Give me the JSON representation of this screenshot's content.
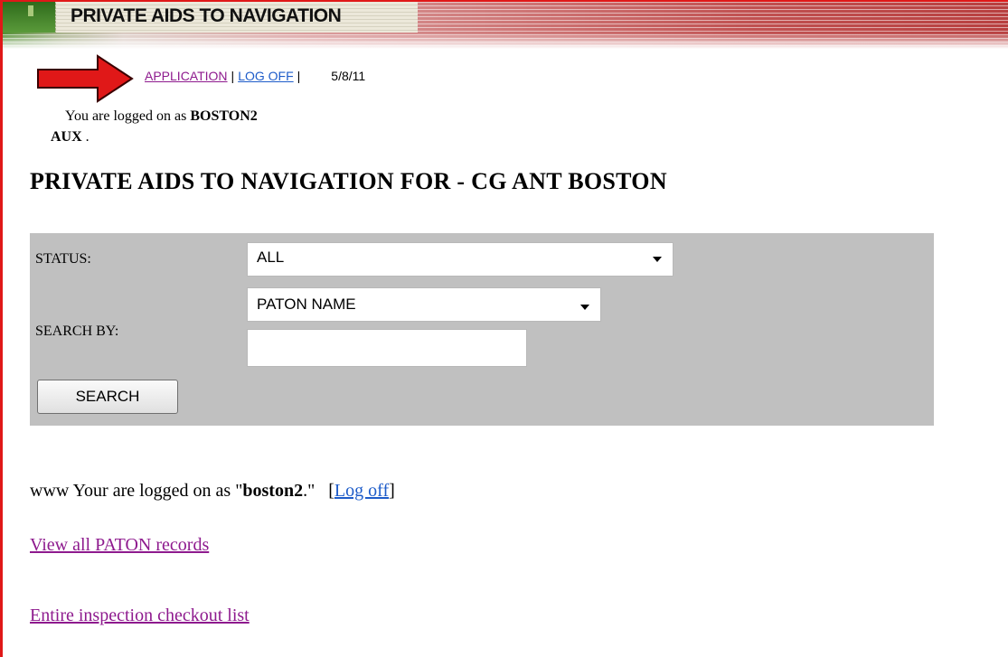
{
  "header": {
    "title": "PRIVATE AIDS TO NAVIGATION"
  },
  "nav": {
    "application": "APPLICATION",
    "log_off": "LOG OFF",
    "separator": "|",
    "date": "5/8/11"
  },
  "session": {
    "logged_prefix": "You are logged on as ",
    "username": "BOSTON2",
    "role": "AUX",
    "role_suffix": " ."
  },
  "page": {
    "title": "PRIVATE AIDS TO NAVIGATION FOR - CG ANT BOSTON"
  },
  "search": {
    "status_label": "STATUS:",
    "status_value": "ALL",
    "search_by_label": "SEARCH BY:",
    "search_by_value": "PATON NAME",
    "search_text": "",
    "button": "SEARCH"
  },
  "footer": {
    "status_prefix": "www Your are logged on as \"",
    "status_user": "boston2",
    "status_suffix": ".\"",
    "bracket_open": "[",
    "log_off": "Log off",
    "bracket_close": "]",
    "view_records": "View all PATON records",
    "checkout_list": "Entire inspection checkout list"
  },
  "colors": {
    "frame": "#e01818",
    "visited_link": "#8e1a8e",
    "link": "#1e5cc9",
    "panel": "#c0c0c0",
    "arrow": "#e01818"
  }
}
